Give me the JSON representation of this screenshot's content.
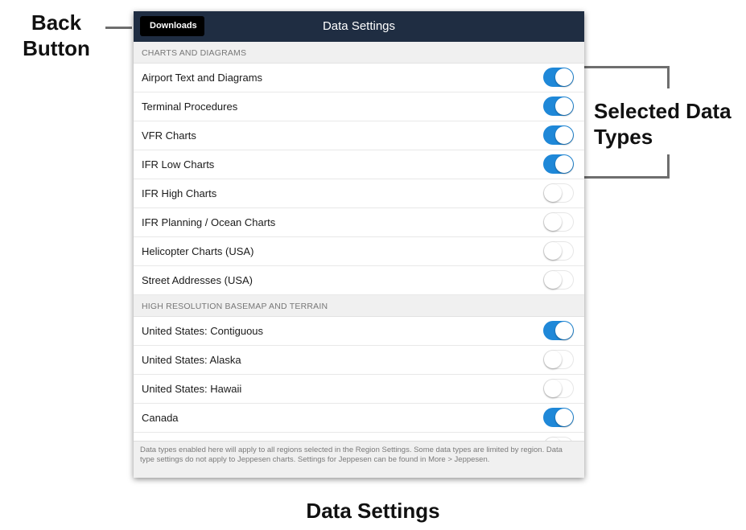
{
  "annotations": {
    "back_button_callout": "Back Button",
    "data_types_callout": "Selected Data Types",
    "caption": "Data Settings"
  },
  "navbar": {
    "back_label": "Downloads",
    "title": "Data Settings"
  },
  "sections": [
    {
      "header": "CHARTS AND DIAGRAMS",
      "rows": [
        {
          "label": "Airport Text and Diagrams",
          "enabled": true
        },
        {
          "label": "Terminal Procedures",
          "enabled": true
        },
        {
          "label": "VFR Charts",
          "enabled": true
        },
        {
          "label": "IFR Low Charts",
          "enabled": true
        },
        {
          "label": "IFR High Charts",
          "enabled": false
        },
        {
          "label": "IFR Planning / Ocean Charts",
          "enabled": false
        },
        {
          "label": "Helicopter Charts (USA)",
          "enabled": false
        },
        {
          "label": "Street Addresses (USA)",
          "enabled": false
        }
      ]
    },
    {
      "header": "HIGH RESOLUTION BASEMAP AND TERRAIN",
      "rows": [
        {
          "label": "United States: Contiguous",
          "enabled": true
        },
        {
          "label": "United States: Alaska",
          "enabled": false
        },
        {
          "label": "United States: Hawaii",
          "enabled": false
        },
        {
          "label": "Canada",
          "enabled": true
        },
        {
          "label": "",
          "enabled": false
        }
      ]
    }
  ],
  "footer": {
    "text": "Data types enabled here will apply to all regions selected in the Region Settings. Some data types are limited by region. Data type settings do not apply to Jeppesen charts. Settings for Jeppesen can be found in More > Jeppesen."
  },
  "colors": {
    "navbar": "#1f2d42",
    "toggle_on": "#1f88d8",
    "section_bg": "#f0f0f0"
  }
}
